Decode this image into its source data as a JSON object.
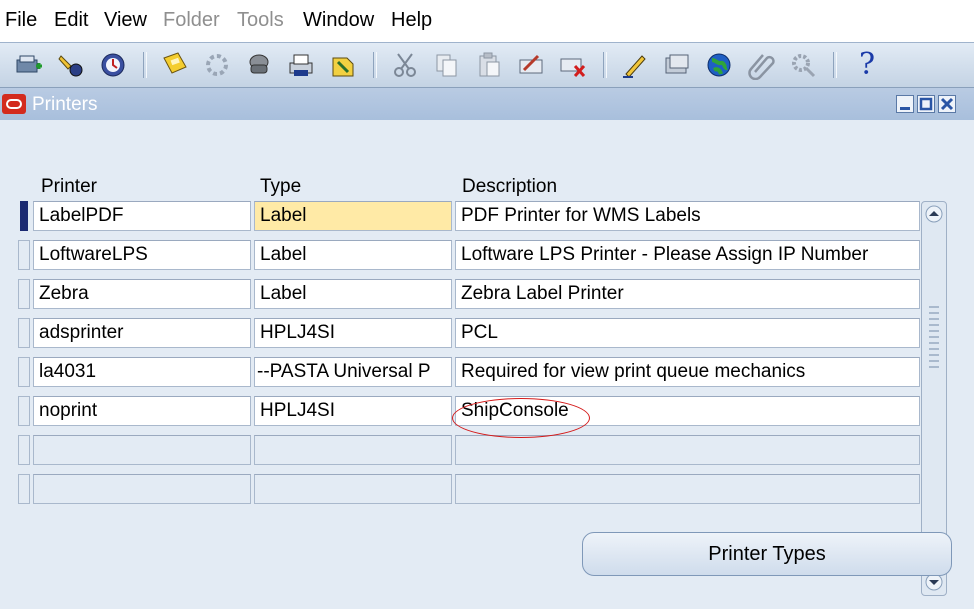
{
  "menu": [
    {
      "label": "File",
      "enabled": true
    },
    {
      "label": "Edit",
      "enabled": true
    },
    {
      "label": "View",
      "enabled": true
    },
    {
      "label": "Folder",
      "enabled": false
    },
    {
      "label": "Tools",
      "enabled": false
    },
    {
      "label": "Window",
      "enabled": true
    },
    {
      "label": "Help",
      "enabled": true
    }
  ],
  "toolbar": {
    "buttons": [
      "new-icon",
      "find-icon",
      "navigator-icon",
      "save-icon",
      "next-step-icon",
      "switch-responsibility-icon",
      "print-icon",
      "close-form-icon",
      "cut-icon",
      "copy-icon",
      "paste-icon",
      "clear-record-icon",
      "delete-record-icon",
      "edit-field-icon",
      "zoom-icon",
      "translations-icon",
      "attachments-icon",
      "folder-tools-icon",
      "help-icon"
    ],
    "help_glyph": "?"
  },
  "window": {
    "title": "Printers"
  },
  "grid": {
    "headers": {
      "printer": "Printer",
      "type": "Type",
      "description": "Description"
    },
    "rows": [
      {
        "printer": "LabelPDF",
        "type": "Label",
        "description": "PDF Printer for WMS Labels",
        "current": true
      },
      {
        "printer": "LoftwareLPS",
        "type": "Label",
        "description": "Loftware LPS Printer - Please Assign IP Number"
      },
      {
        "printer": "Zebra",
        "type": "Label",
        "description": "Zebra Label Printer"
      },
      {
        "printer": "adsprinter",
        "type": "HPLJ4SI",
        "description": "PCL"
      },
      {
        "printer": "la4031",
        "type": "--PASTA Universal P",
        "description": "Required for view print queue mechanics"
      },
      {
        "printer": "noprint",
        "type": "HPLJ4SI",
        "description": "ShipConsole"
      },
      {
        "printer": "",
        "type": "",
        "description": ""
      },
      {
        "printer": "",
        "type": "",
        "description": ""
      }
    ]
  },
  "buttons": {
    "printer_types": "Printer Types"
  },
  "colors": {
    "active_field": "#ffeaa6",
    "annotation": "#d41a1a",
    "oracle_logo": "#d32b1e"
  }
}
